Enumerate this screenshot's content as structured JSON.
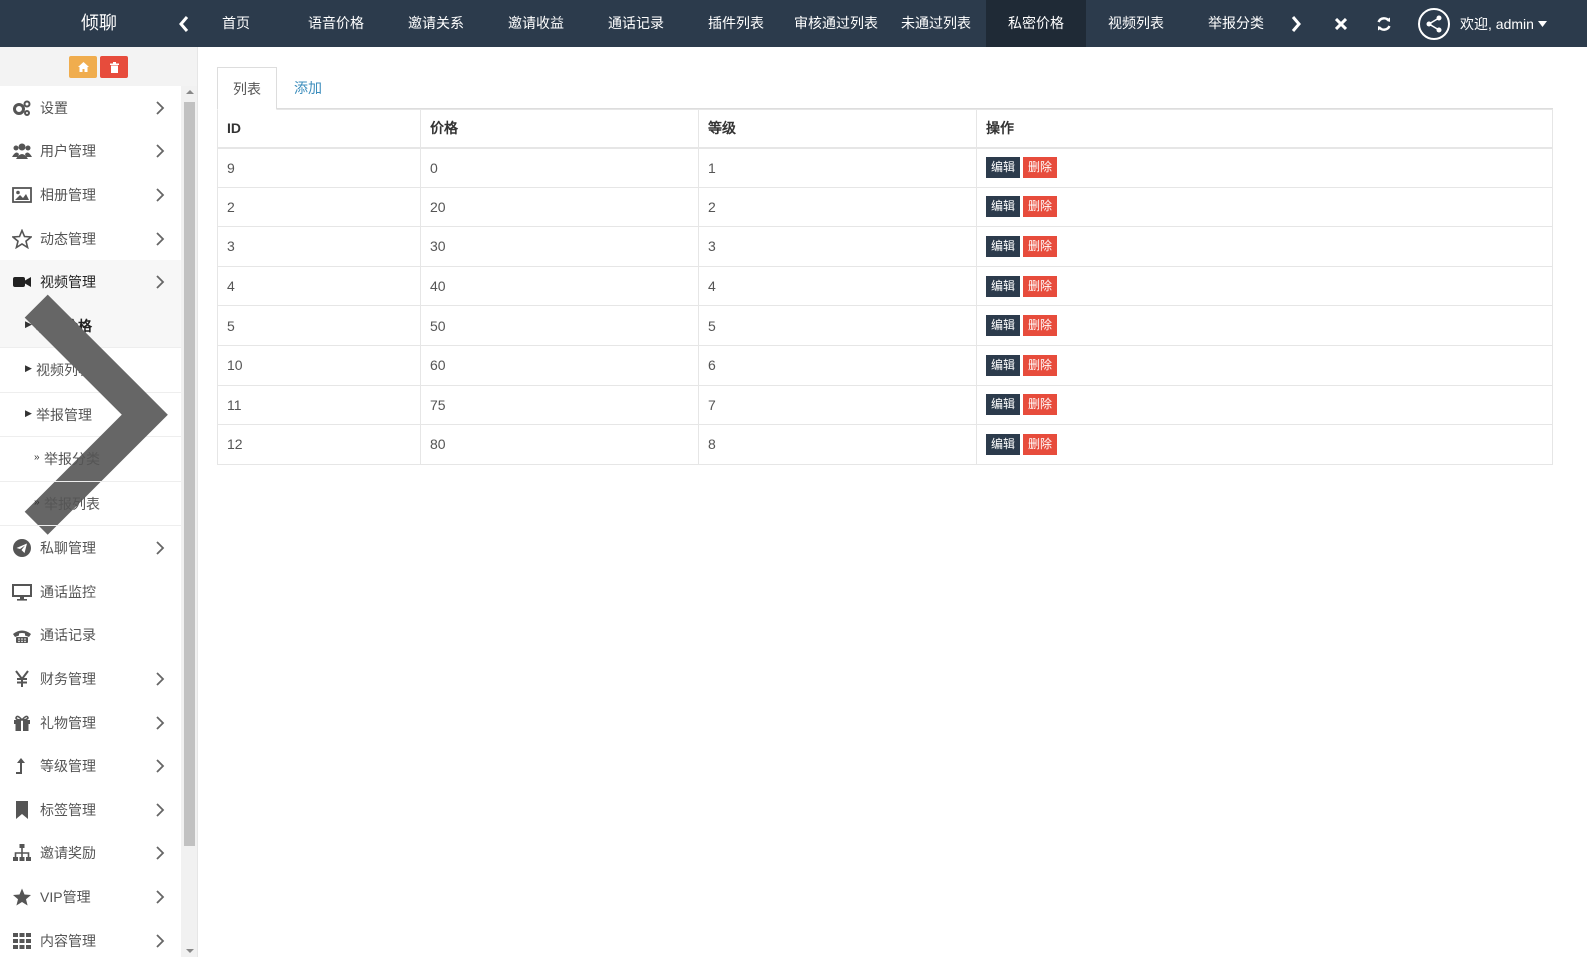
{
  "app": {
    "title": "倾聊"
  },
  "header": {
    "tabs": [
      {
        "label": "首页"
      },
      {
        "label": "语音价格"
      },
      {
        "label": "邀请关系"
      },
      {
        "label": "邀请收益"
      },
      {
        "label": "通话记录"
      },
      {
        "label": "插件列表"
      },
      {
        "label": "审核通过列表"
      },
      {
        "label": "未通过列表"
      },
      {
        "label": "私密价格"
      },
      {
        "label": "视频列表"
      },
      {
        "label": "举报分类"
      }
    ],
    "active_tab": "私密价格",
    "user_label": "欢迎, admin"
  },
  "sidebar": {
    "items": [
      {
        "label": "设置",
        "icon": "cogs-icon"
      },
      {
        "label": "用户管理",
        "icon": "users-icon"
      },
      {
        "label": "相册管理",
        "icon": "image-icon"
      },
      {
        "label": "动态管理",
        "icon": "star-outline-icon"
      },
      {
        "label": "视频管理",
        "icon": "video-camera-icon"
      }
    ],
    "video_sub": [
      {
        "label": "私密价格"
      },
      {
        "label": "视频列表"
      },
      {
        "label": "举报管理"
      }
    ],
    "report_sub": [
      {
        "label": "举报分类"
      },
      {
        "label": "举报列表"
      }
    ],
    "items_after": [
      {
        "label": "私聊管理",
        "icon": "telegram-icon",
        "chevron": true
      },
      {
        "label": "通话监控",
        "icon": "desktop-icon",
        "chevron": false
      },
      {
        "label": "通话记录",
        "icon": "phone-icon",
        "chevron": false
      },
      {
        "label": "财务管理",
        "icon": "yen-icon",
        "chevron": true
      },
      {
        "label": "礼物管理",
        "icon": "gift-icon",
        "chevron": true
      },
      {
        "label": "等级管理",
        "icon": "level-up-icon",
        "chevron": true
      },
      {
        "label": "标签管理",
        "icon": "bookmark-icon",
        "chevron": true
      },
      {
        "label": "邀请奖励",
        "icon": "sitemap-icon",
        "chevron": true
      },
      {
        "label": "VIP管理",
        "icon": "star-icon",
        "chevron": true
      },
      {
        "label": "内容管理",
        "icon": "grid-icon",
        "chevron": true
      }
    ]
  },
  "content": {
    "tabs": {
      "list": "列表",
      "add": "添加"
    },
    "columns": [
      "ID",
      "价格",
      "等级",
      "操作"
    ],
    "rows": [
      {
        "id": "9",
        "price": "0",
        "level": "1"
      },
      {
        "id": "2",
        "price": "20",
        "level": "2"
      },
      {
        "id": "3",
        "price": "30",
        "level": "3"
      },
      {
        "id": "4",
        "price": "40",
        "level": "4"
      },
      {
        "id": "5",
        "price": "50",
        "level": "5"
      },
      {
        "id": "10",
        "price": "60",
        "level": "6"
      },
      {
        "id": "11",
        "price": "75",
        "level": "7"
      },
      {
        "id": "12",
        "price": "80",
        "level": "8"
      }
    ],
    "actions": {
      "edit": "编辑",
      "delete": "删除"
    }
  },
  "colors": {
    "nav_bg": "#2c3b4c",
    "active_tab_bg": "#1f2a36",
    "edit_btn": "#2c3b4c",
    "delete_btn": "#e74c3c",
    "home_btn": "#f0ad4e"
  }
}
